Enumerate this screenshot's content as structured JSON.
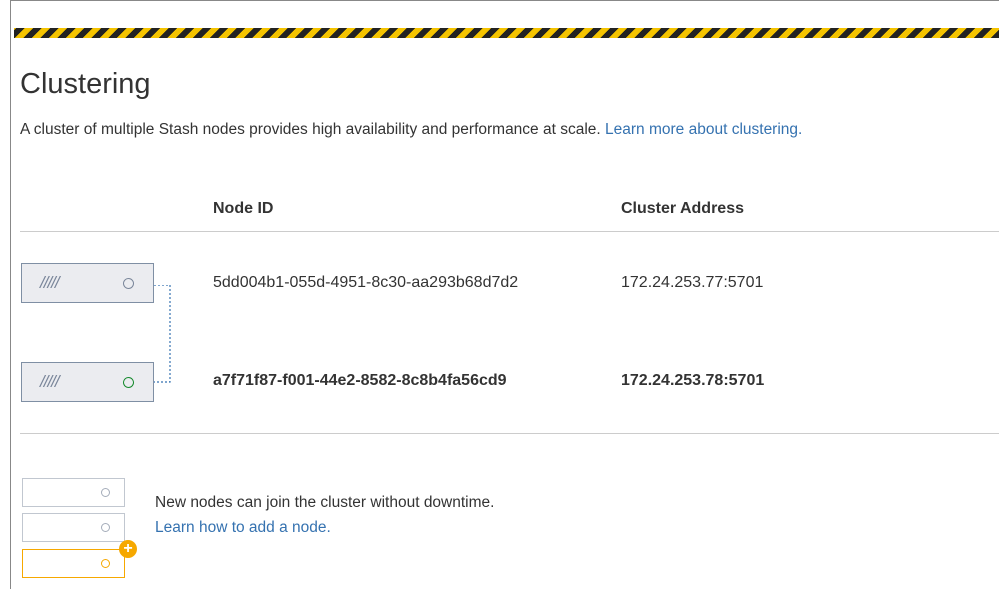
{
  "page": {
    "title": "Clustering",
    "intro_text": "A cluster of multiple Stash nodes provides high availability and performance at scale.",
    "intro_link": "Learn more about clustering."
  },
  "table": {
    "headers": {
      "node_id": "Node ID",
      "cluster_address": "Cluster Address"
    },
    "rows": [
      {
        "node_id": "5dd004b1-055d-4951-8c30-aa293b68d7d2",
        "cluster_address": "172.24.253.77:5701",
        "current": false
      },
      {
        "node_id": "a7f71f87-f001-44e2-8582-8c8b4fa56cd9",
        "cluster_address": "172.24.253.78:5701",
        "current": true
      }
    ]
  },
  "add_node": {
    "text": "New nodes can join the cluster without downtime.",
    "link": "Learn how to add a node."
  },
  "icons": {
    "node": "server-node-icon",
    "status_active_color": "#14892c",
    "status_idle_color": "#7a869a",
    "add": "plus-icon",
    "add_color": "#f6a800"
  },
  "colors": {
    "link": "#3572b0",
    "hazard_dark": "#222222",
    "hazard_light": "#f5c400"
  }
}
